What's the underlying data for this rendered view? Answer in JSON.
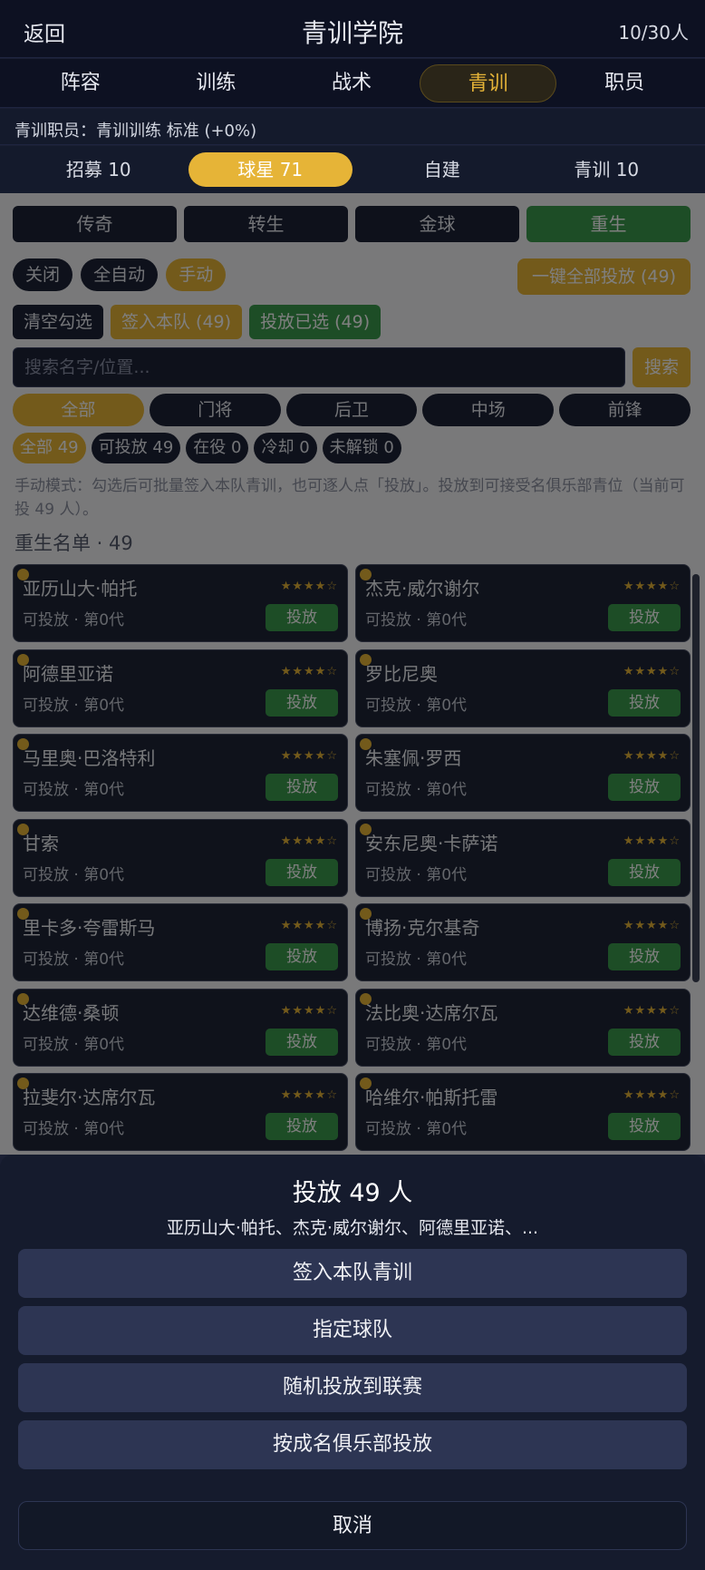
{
  "header": {
    "back_label": "返回",
    "title": "青训学院",
    "count": "10/30人"
  },
  "main_tabs": [
    {
      "label": "阵容",
      "active": false
    },
    {
      "label": "训练",
      "active": false
    },
    {
      "label": "战术",
      "active": false
    },
    {
      "label": "青训",
      "active": true
    },
    {
      "label": "职员",
      "active": false
    }
  ],
  "staff_line": "青训职员：青训训练 标准 (+0%)",
  "sub_tabs": [
    {
      "label": "招募 10",
      "active": false
    },
    {
      "label": "球星 71",
      "active": true
    },
    {
      "label": "自建",
      "active": false
    },
    {
      "label": "青训 10",
      "active": false
    }
  ],
  "mode_buttons": [
    "传奇",
    "转生",
    "金球",
    "重生"
  ],
  "auto_options": [
    {
      "label": "关闭",
      "style": "dark"
    },
    {
      "label": "全自动",
      "style": "dark"
    },
    {
      "label": "手动",
      "style": "gold"
    }
  ],
  "release_all_label": "一键全部投放 (49)",
  "selection_buttons": [
    {
      "label": "清空勾选",
      "style": "dark"
    },
    {
      "label": "签入本队 (49)",
      "style": "gold"
    },
    {
      "label": "投放已选 (49)",
      "style": "green"
    }
  ],
  "search": {
    "placeholder": "搜索名字/位置...",
    "button_label": "搜索"
  },
  "positions": [
    {
      "label": "全部",
      "active": true
    },
    {
      "label": "门将",
      "active": false
    },
    {
      "label": "后卫",
      "active": false
    },
    {
      "label": "中场",
      "active": false
    },
    {
      "label": "前锋",
      "active": false
    }
  ],
  "status_filters": [
    {
      "label": "全部 49",
      "active": true
    },
    {
      "label": "可投放 49",
      "active": false
    },
    {
      "label": "在役 0",
      "active": false
    },
    {
      "label": "冷却 0",
      "active": false
    },
    {
      "label": "未解锁 0",
      "active": false
    }
  ],
  "hint": "手动模式：勾选后可批量签入本队青训，也可逐人点「投放」。投放到可接受名俱乐部青位（当前可投 49 人）。",
  "section_title": "重生名单 · 49",
  "player_card": {
    "stars": "★★★★☆",
    "status": "可投放 · 第0代",
    "release_label": "投放"
  },
  "players": [
    "亚历山大·帕托",
    "杰克·威尔谢尔",
    "阿德里亚诺",
    "罗比尼奥",
    "马里奥·巴洛特利",
    "朱塞佩·罗西",
    "甘索",
    "安东尼奥·卡萨诺",
    "里卡多·夸雷斯马",
    "博扬·克尔基奇",
    "达维德·桑顿",
    "法比奥·达席尔瓦",
    "拉斐尔·达席尔瓦",
    "哈维尔·帕斯托雷"
  ],
  "sheet": {
    "title": "投放 49 人",
    "subtitle": "亚历山大·帕托、杰克·威尔谢尔、阿德里亚诺、...",
    "actions": [
      "签入本队青训",
      "指定球队",
      "随机投放到联赛",
      "按成名俱乐部投放"
    ],
    "cancel_label": "取消"
  }
}
